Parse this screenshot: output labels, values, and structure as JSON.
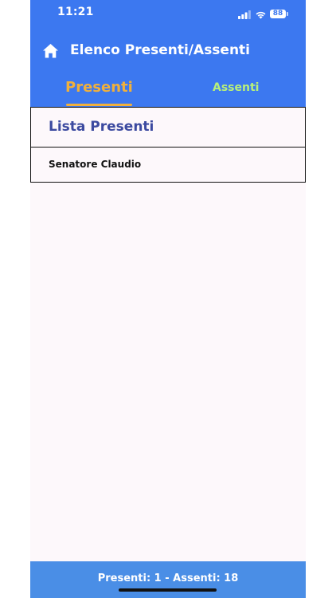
{
  "status_bar": {
    "time": "11:21",
    "battery": "88"
  },
  "header": {
    "title": "Elenco Presenti/Assenti"
  },
  "tabs": [
    {
      "label": "Presenti",
      "active": true
    },
    {
      "label": "Assenti",
      "active": false
    }
  ],
  "list": {
    "header": "Lista Presenti",
    "items": [
      {
        "name": "Senatore Claudio"
      }
    ]
  },
  "footer": {
    "summary": "Presenti: 1 - Assenti: 18"
  },
  "colors": {
    "header_bg": "#3c78f0",
    "active_tab": "#f0b03c",
    "inactive_tab": "#b8f07a",
    "list_title": "#3c4aa0",
    "footer_bg": "#4a8ee6",
    "page_bg": "#fdf8fb"
  },
  "icons": {
    "home": "home-icon",
    "signal": "cellular-signal-icon",
    "wifi": "wifi-icon",
    "battery": "battery-icon"
  }
}
